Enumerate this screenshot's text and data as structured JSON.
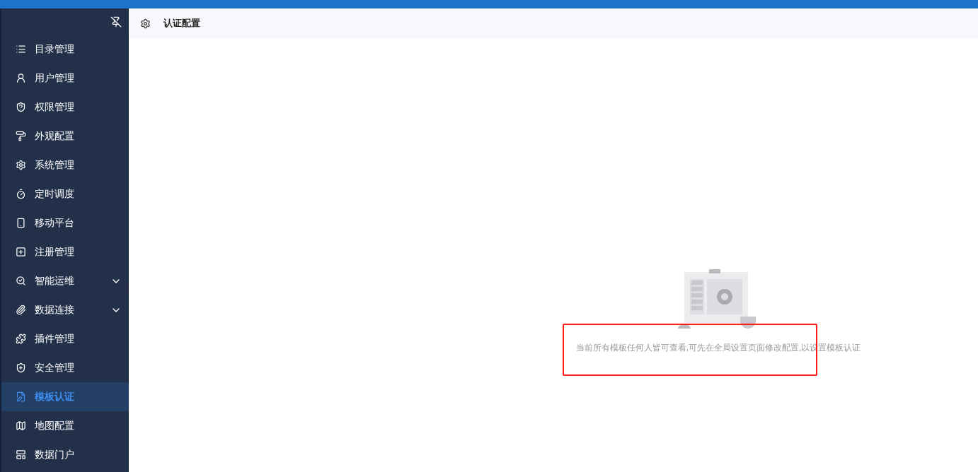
{
  "sidebar": {
    "items": [
      {
        "label": "目录管理",
        "kind": "link",
        "selected": false
      },
      {
        "label": "用户管理",
        "kind": "link",
        "selected": false
      },
      {
        "label": "权限管理",
        "kind": "link",
        "selected": false
      },
      {
        "label": "外观配置",
        "kind": "link",
        "selected": false
      },
      {
        "label": "系统管理",
        "kind": "link",
        "selected": false
      },
      {
        "label": "定时调度",
        "kind": "link",
        "selected": false
      },
      {
        "label": "移动平台",
        "kind": "link",
        "selected": false
      },
      {
        "label": "注册管理",
        "kind": "link",
        "selected": false
      },
      {
        "label": "智能运维",
        "kind": "group",
        "selected": false
      },
      {
        "label": "数据连接",
        "kind": "group",
        "selected": false
      },
      {
        "label": "插件管理",
        "kind": "link",
        "selected": false
      },
      {
        "label": "安全管理",
        "kind": "link",
        "selected": false
      },
      {
        "label": "模板认证",
        "kind": "link",
        "selected": true
      },
      {
        "label": "地图配置",
        "kind": "link",
        "selected": false
      },
      {
        "label": "数据门户",
        "kind": "link",
        "selected": false
      }
    ]
  },
  "header": {
    "title": "认证配置"
  },
  "empty_state": {
    "message": "当前所有模板任何人皆可查看,可先在全局设置页面修改配置,以设置模板认证"
  }
}
